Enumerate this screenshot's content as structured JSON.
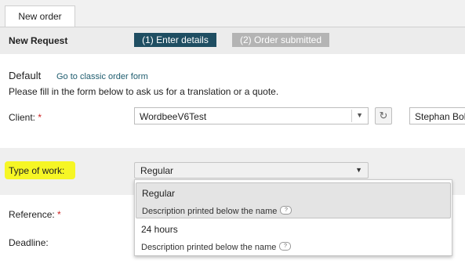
{
  "tabs": [
    {
      "label": "New order"
    }
  ],
  "request": {
    "title": "New Request",
    "steps": [
      {
        "label": "(1) Enter details",
        "active": true
      },
      {
        "label": "(2) Order submitted",
        "active": false
      }
    ]
  },
  "form": {
    "heading": "Default",
    "classic_link": "Go to classic order form",
    "instructions": "Please fill in the form below to ask us for a translation or a quote.",
    "client": {
      "label": "Client:",
      "required_mark": "*",
      "value": "WordbeeV6Test",
      "user_value": "Stephan Bol"
    },
    "type_of_work": {
      "label": "Type of work:",
      "value": "Regular",
      "options": [
        {
          "name": "Regular",
          "description": "Description printed below the name",
          "selected": true
        },
        {
          "name": "24 hours",
          "description": "Description printed below the name",
          "selected": false
        }
      ]
    },
    "reference": {
      "label": "Reference:",
      "required_mark": "*"
    },
    "deadline": {
      "label": "Deadline:"
    }
  },
  "icons": {
    "dropdown_arrow": "triangle-down-icon",
    "refresh": "refresh-icon",
    "help": "help-bubble-icon"
  },
  "colors": {
    "step_active": "#1f4e62",
    "step_inactive": "#b4b4b4",
    "highlight": "#f5f519",
    "required": "#cc2222",
    "link": "#1e5c6e"
  }
}
